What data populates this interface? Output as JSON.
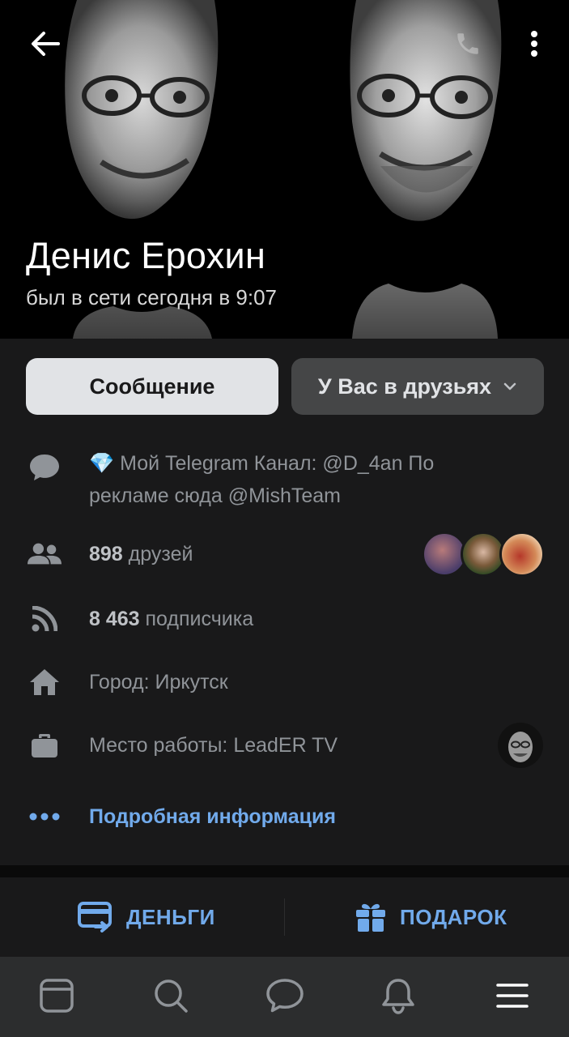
{
  "header": {
    "back_icon": "arrow-left-icon",
    "call_icon": "phone-icon",
    "more_icon": "more-vertical-icon"
  },
  "profile": {
    "name": "Денис Ерохин",
    "status": "был в сети сегодня в 9:07"
  },
  "buttons": {
    "message_label": "Сообщение",
    "friends_label": "У Вас в друзьях"
  },
  "info": {
    "bio_emoji": "💎",
    "bio": "Мой Telegram Канал: @D_4an По рекламе сюда @MishTeam",
    "friends_count": "898",
    "friends_suffix": "друзей",
    "followers_count": "8 463",
    "followers_suffix": "подписчика",
    "city": "Город: Иркутск",
    "work": "Место работы: LeadER TV",
    "more_info": "Подробная информация"
  },
  "actions": {
    "money_label": "ДЕНЬГИ",
    "gift_label": "ПОДАРОК"
  },
  "nav": {
    "items": [
      "news-icon",
      "search-icon",
      "messages-icon",
      "notifications-icon",
      "menu-icon"
    ]
  },
  "colors": {
    "accent": "#71aaeb",
    "panel": "#19191a",
    "nav_bg": "#2c2d2e",
    "muted_text": "#909499"
  }
}
